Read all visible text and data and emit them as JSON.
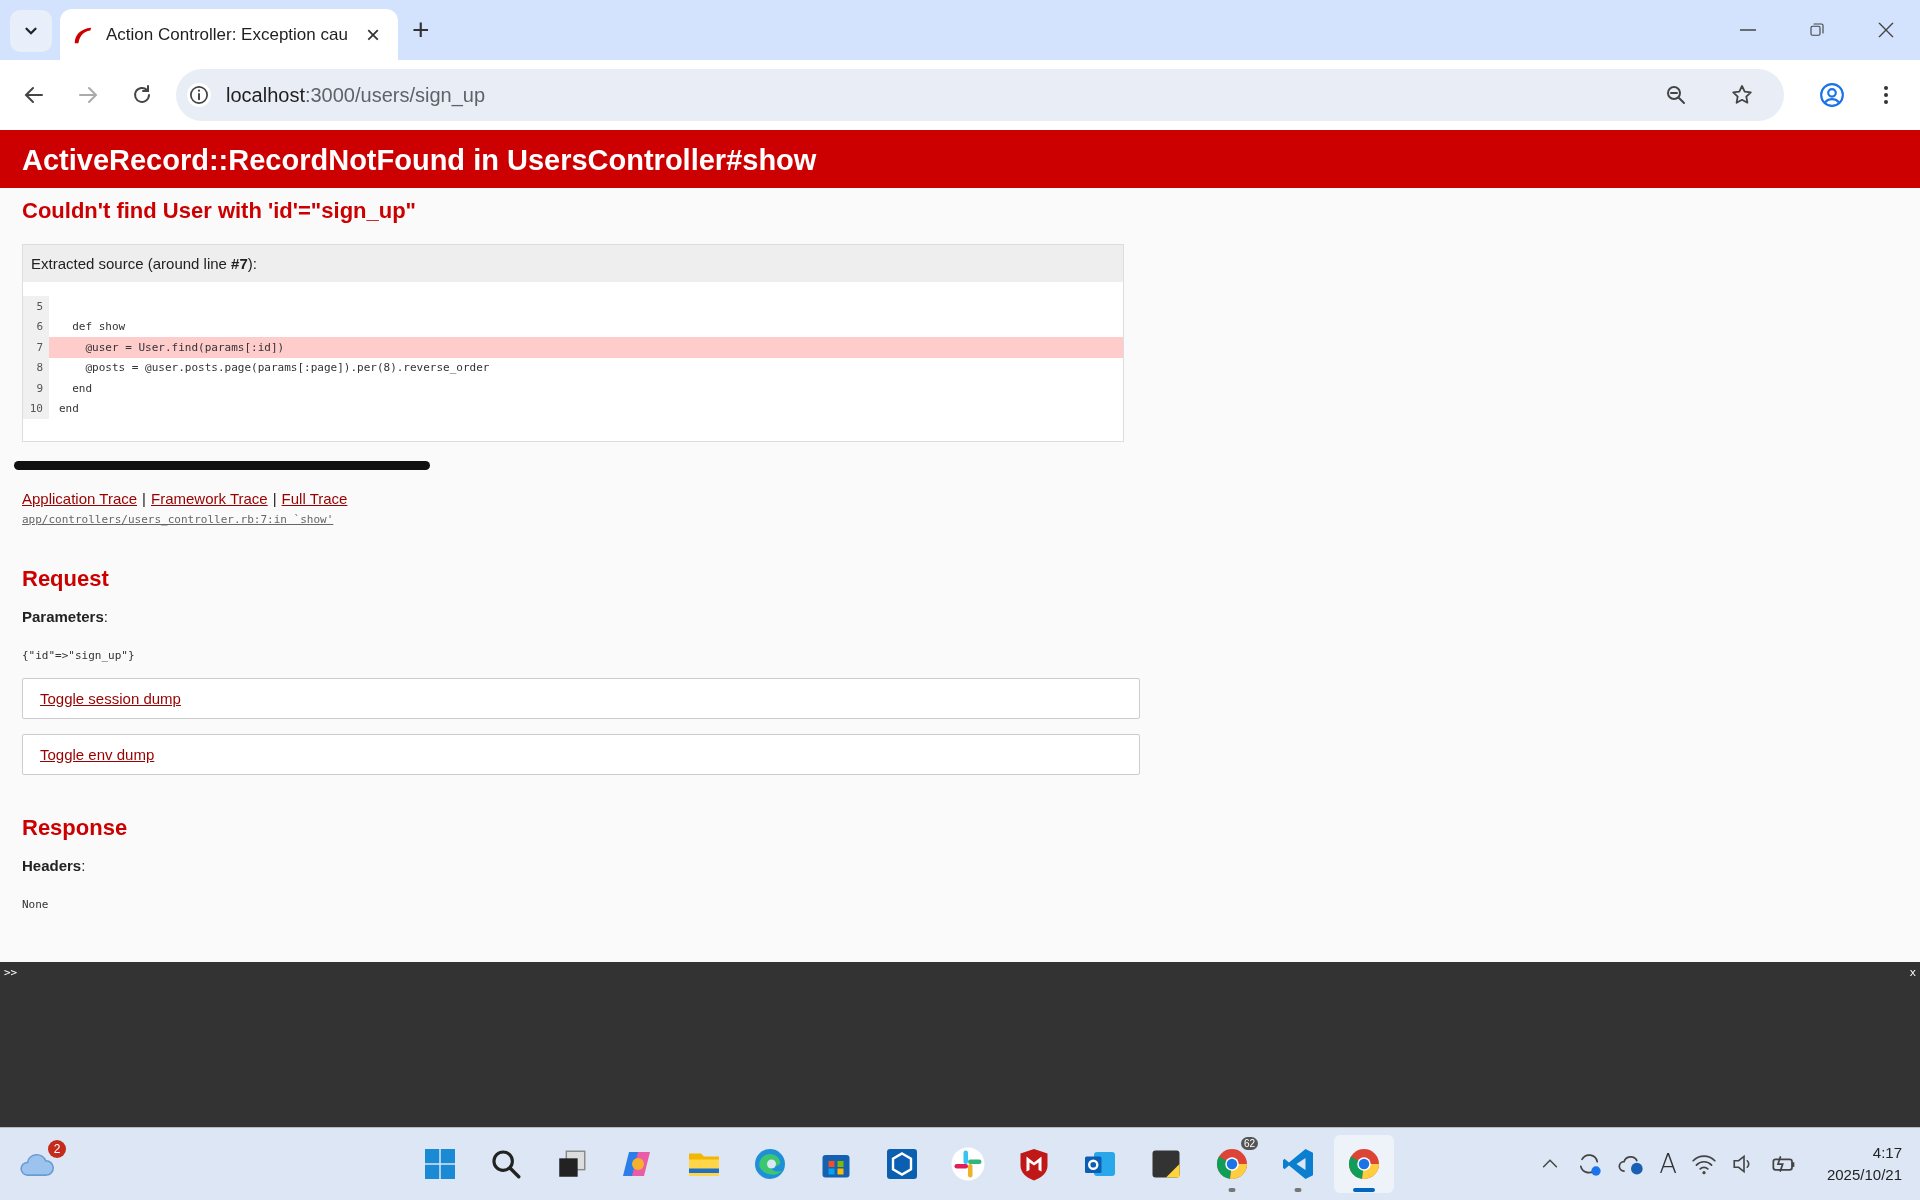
{
  "browser": {
    "tab": {
      "title": "Action Controller: Exception cau",
      "close": "×"
    },
    "new_tab": "+",
    "url": {
      "host": "localhost",
      "path": ":3000/users/sign_up"
    }
  },
  "page": {
    "title": "ActiveRecord::RecordNotFound in UsersController#show",
    "message": "Couldn't find User with 'id'=\"sign_up\"",
    "source": {
      "header": "Extracted source (around line **#7**):",
      "lines": [
        {
          "number": "5",
          "selected": false
        },
        {
          "number": "6",
          "code": "  def show",
          "selected": false
        },
        {
          "number": "7",
          "code": "    @user = User.find(params[:id])",
          "selected": true
        },
        {
          "number": "8",
          "code": "    @posts = @user.posts.page(params[:page]).per(8).reverse_order",
          "selected": false
        },
        {
          "number": "9",
          "code": "  end",
          "selected": false
        },
        {
          "number": "10",
          "code": "end",
          "selected": false
        }
      ]
    },
    "trace_links": [
      "Application Trace",
      "Framework Trace",
      "Full Trace"
    ],
    "trace_separator": "|",
    "trace": "app/controllers/users_controller.rb:7:in `show'",
    "request": {
      "heading": "Request",
      "parameters_label": "**Parameters**:",
      "parameters": "{\"id\"=>\"sign_up\"}",
      "toggles": [
        "Toggle session dump",
        "Toggle env dump"
      ]
    },
    "response": {
      "heading": "Response",
      "headers_label": "**Headers**:",
      "headers": "None"
    }
  },
  "console": {
    "prompt": ">>",
    "close": "x"
  },
  "taskbar": {
    "weather_badge": "2",
    "apps": [
      {
        "kind": "windows",
        "running": false,
        "selected": false
      },
      {
        "kind": "search",
        "running": false,
        "selected": false
      },
      {
        "kind": "taskview",
        "running": false,
        "selected": false
      },
      {
        "kind": "copilot",
        "running": false,
        "selected": false
      },
      {
        "kind": "folder",
        "running": false,
        "selected": false
      },
      {
        "kind": "edge",
        "running": false,
        "selected": false
      },
      {
        "kind": "store",
        "running": false,
        "selected": false
      },
      {
        "kind": "cube",
        "running": false,
        "selected": false
      },
      {
        "kind": "slack",
        "running": false,
        "selected": false
      },
      {
        "kind": "shield",
        "running": false,
        "selected": false
      },
      {
        "kind": "mail",
        "running": false,
        "selected": false
      },
      {
        "kind": "note",
        "running": false,
        "selected": false
      },
      {
        "kind": "chrome",
        "running": true,
        "selected": false,
        "badge": "62"
      },
      {
        "kind": "code",
        "running": true,
        "selected": false
      },
      {
        "kind": "chrome",
        "running": true,
        "selected": true
      }
    ],
    "ime": "A",
    "time": "4:17",
    "date": "2025/10/21"
  }
}
